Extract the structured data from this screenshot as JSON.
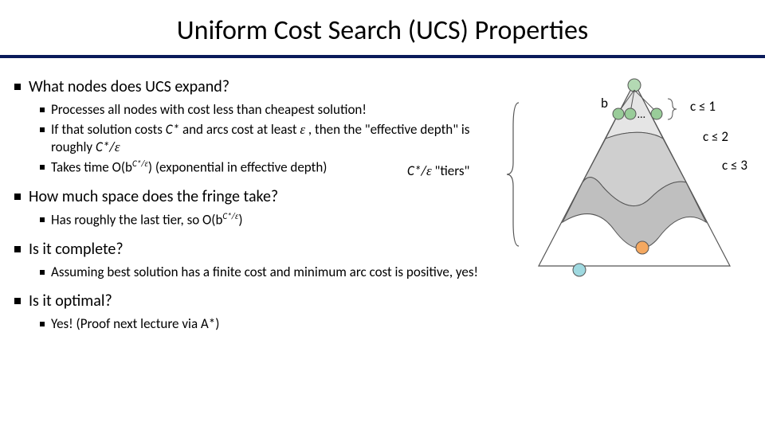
{
  "title": "Uniform Cost Search (UCS) Properties",
  "q1": {
    "text": "What nodes does UCS expand?",
    "subs": [
      {
        "pre": "Processes all nodes with cost less than cheapest solution!"
      },
      {
        "pre": "If that solution costs ",
        "it1": "C*",
        "mid": " and arcs cost at least ",
        "eps1": "ε",
        "mid2": " , then the \"effective depth\" is roughly ",
        "it2": "C*/",
        "eps2": "ε"
      },
      {
        "pre": "Takes time O(b",
        "sup_it": "C*/",
        "sup_eps": "ε",
        "post": ") (exponential in effective depth)"
      }
    ]
  },
  "q2": {
    "text": "How much space does the fringe take?",
    "subs": [
      {
        "pre": "Has roughly the last tier, so O(b",
        "sup_it": "C*/",
        "sup_eps": "ε",
        "post": ")"
      }
    ]
  },
  "q3": {
    "text": "Is it complete?",
    "subs": [
      {
        "pre": "Assuming best solution has a finite cost and minimum arc cost is positive, yes!"
      }
    ]
  },
  "q4": {
    "text": "Is it optimal?",
    "subs": [
      {
        "pre": "Yes!  (Proof next lecture via A*)"
      }
    ]
  },
  "figure": {
    "tiers_label_it": "C*/",
    "tiers_label_eps": "ε",
    "tiers_label_q": "  \"tiers\"",
    "b_label": "b",
    "dots": "…",
    "c1_pre": "c ",
    "le": "≤",
    "c1_post": " 1",
    "c2_pre": "c ",
    "c2_post": " 2",
    "c3_pre": "c ",
    "c3_post": " 3",
    "colors": {
      "grayFillLight": "#e5e5e5",
      "grayFillMid": "#cfcfcf",
      "grayFillDark": "#bfbfbf",
      "nodeA": "#99cc99",
      "nodeTop": "#b3d9b3",
      "nodeOrange": "#f4a860",
      "nodeCyan": "#9fd9e0",
      "stroke": "#555"
    }
  }
}
